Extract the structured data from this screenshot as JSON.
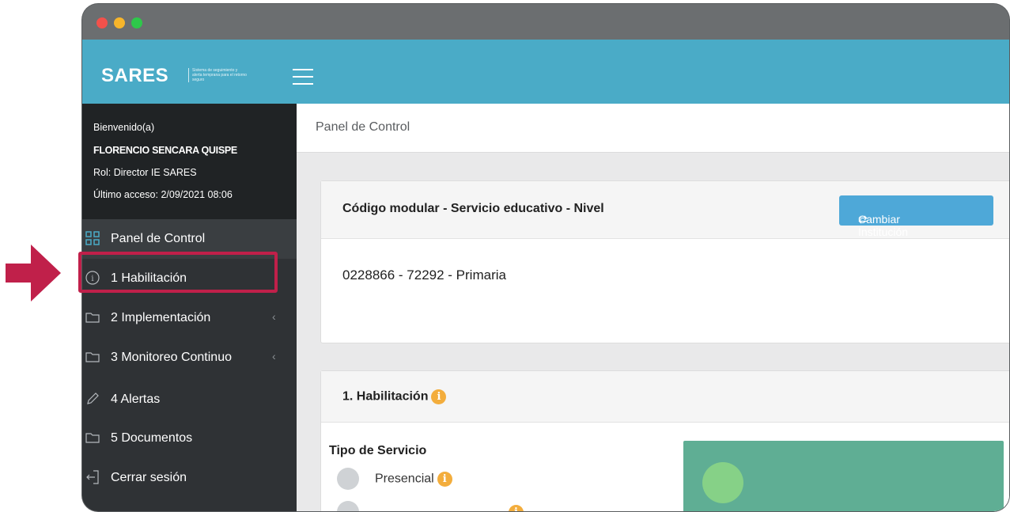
{
  "window": {
    "dots": [
      "close",
      "minimize",
      "maximize"
    ]
  },
  "appbar": {
    "logo": "SARES",
    "tagline": "Sistema de seguimiento y alerta temprana para el retorno seguro",
    "menu_icon": "hamburger-icon"
  },
  "user": {
    "welcome": "Bienvenido(a)",
    "name": "FLORENCIO SENCARA QUISPE",
    "role": "Rol: Director IE SARES",
    "last_access": "Último acceso: 2/09/2021 08:06"
  },
  "nav": {
    "items": [
      {
        "label": "Panel de Control",
        "icon": "grid-icon",
        "active": true
      },
      {
        "label": "1 Habilitación",
        "icon": "info-circle-icon",
        "highlighted": true
      },
      {
        "label": "2 Implementación",
        "icon": "folder-icon",
        "chevron": "‹"
      },
      {
        "label": "3 Monitoreo Continuo",
        "icon": "folder-icon",
        "chevron": "‹"
      },
      {
        "label": "4 Alertas",
        "icon": "pencil-icon"
      },
      {
        "label": "5 Documentos",
        "icon": "folder-icon"
      },
      {
        "label": "Cerrar sesión",
        "icon": "logout-icon"
      }
    ]
  },
  "page": {
    "breadcrumb": "Panel de Control"
  },
  "institution_card": {
    "title": "Código modular - Servicio educativo - Nivel",
    "change_button": "Cambiar Institución",
    "value": "0228866 - 72292 - Primaria"
  },
  "habilitacion_card": {
    "title": "1. Habilitación",
    "info_glyph": "i",
    "service_type_label": "Tipo de Servicio",
    "options": [
      "Presencial"
    ]
  },
  "colors": {
    "appbar": "#4aabc7",
    "sidebar": "#2f3235",
    "button": "#4ea8d8",
    "highlight": "#c0204a",
    "info": "#f3ad3c",
    "panel_green": "#5fae94"
  }
}
